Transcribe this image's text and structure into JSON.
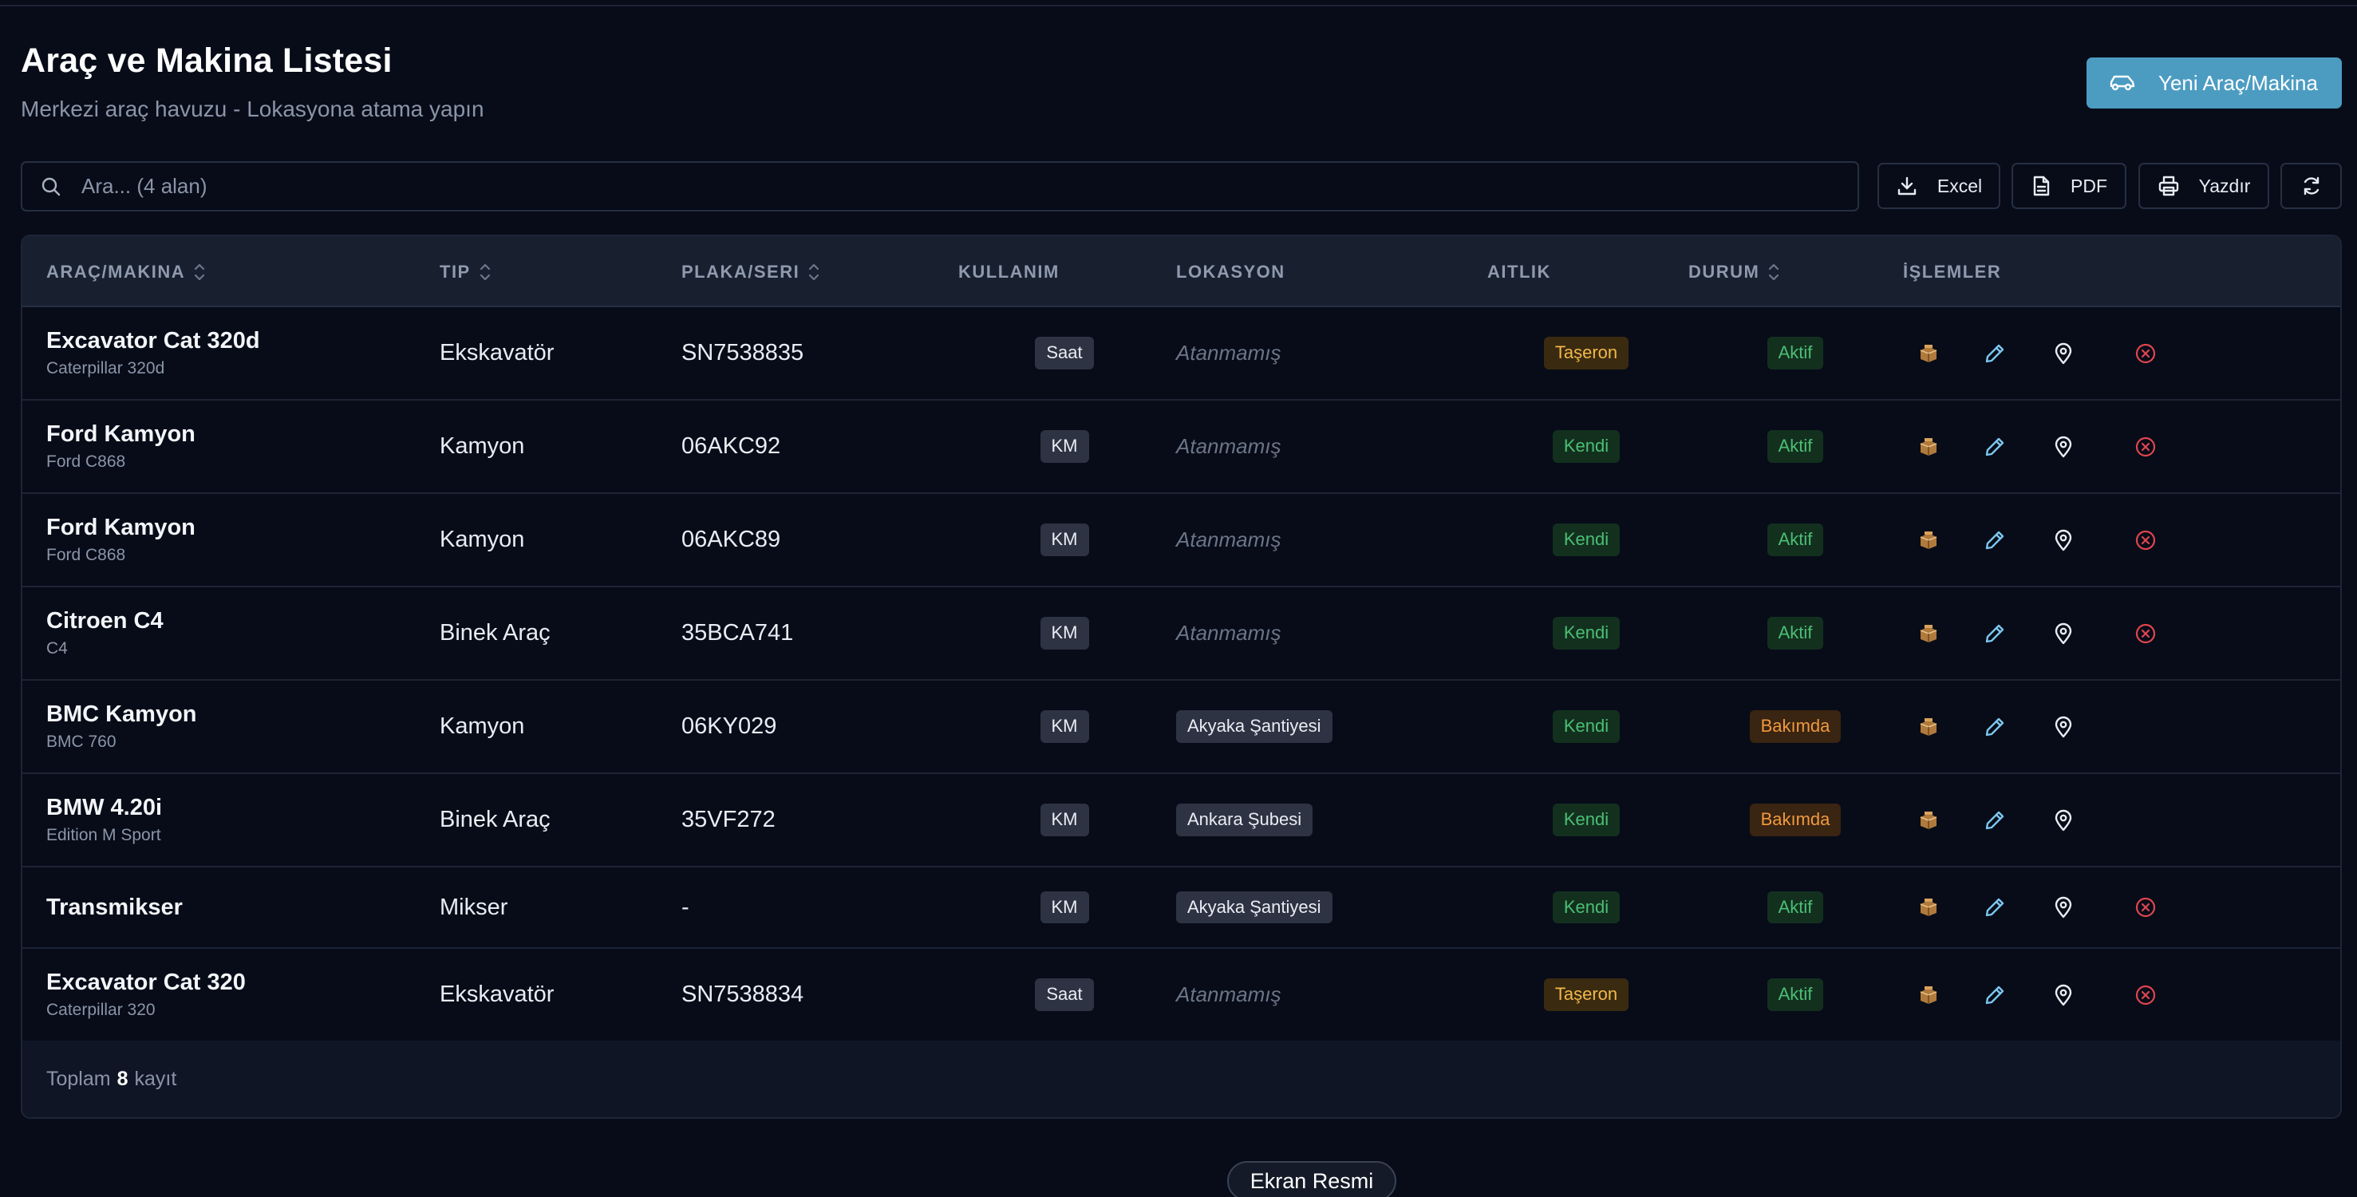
{
  "page": {
    "title": "Araç ve Makina Listesi",
    "subtitle": "Merkezi araç havuzu - Lokasyona atama yapın",
    "new_button": "Yeni Araç/Makina"
  },
  "search": {
    "placeholder": "Ara... (4 alan)"
  },
  "toolbar": {
    "excel": "Excel",
    "pdf": "PDF",
    "print": "Yazdır"
  },
  "columns": {
    "vehicle": "ARAÇ/MAKINA",
    "type": "TIP",
    "plate": "PLAKA/SERI",
    "usage": "KULLANIM",
    "location": "LOKASYON",
    "ownership": "AITLIK",
    "status": "DURUM",
    "actions": "İŞLEMLER"
  },
  "rows": [
    {
      "name": "Excavator Cat 320d",
      "model": "Caterpillar 320d",
      "type": "Ekskavatör",
      "plate": "SN7538835",
      "usage": "Saat",
      "location": "Atanmamış",
      "location_assigned": false,
      "ownership": "Taşeron",
      "status": "Aktif",
      "deletable": true
    },
    {
      "name": "Ford Kamyon",
      "model": "Ford C868",
      "type": "Kamyon",
      "plate": "06AKC92",
      "usage": "KM",
      "location": "Atanmamış",
      "location_assigned": false,
      "ownership": "Kendi",
      "status": "Aktif",
      "deletable": true
    },
    {
      "name": "Ford Kamyon",
      "model": "Ford C868",
      "type": "Kamyon",
      "plate": "06AKC89",
      "usage": "KM",
      "location": "Atanmamış",
      "location_assigned": false,
      "ownership": "Kendi",
      "status": "Aktif",
      "deletable": true
    },
    {
      "name": "Citroen C4",
      "model": "C4",
      "type": "Binek Araç",
      "plate": "35BCA741",
      "usage": "KM",
      "location": "Atanmamış",
      "location_assigned": false,
      "ownership": "Kendi",
      "status": "Aktif",
      "deletable": true
    },
    {
      "name": "BMC Kamyon",
      "model": "BMC 760",
      "type": "Kamyon",
      "plate": "06KY029",
      "usage": "KM",
      "location": "Akyaka Şantiyesi",
      "location_assigned": true,
      "ownership": "Kendi",
      "status": "Bakımda",
      "deletable": false
    },
    {
      "name": "BMW 4.20i",
      "model": "Edition M Sport",
      "type": "Binek Araç",
      "plate": "35VF272",
      "usage": "KM",
      "location": "Ankara Şubesi",
      "location_assigned": true,
      "ownership": "Kendi",
      "status": "Bakımda",
      "deletable": false
    },
    {
      "name": "Transmikser",
      "model": "",
      "type": "Mikser",
      "plate": "-",
      "usage": "KM",
      "location": "Akyaka Şantiyesi",
      "location_assigned": true,
      "ownership": "Kendi",
      "status": "Aktif",
      "deletable": true
    },
    {
      "name": "Excavator Cat 320",
      "model": "Caterpillar 320",
      "type": "Ekskavatör",
      "plate": "SN7538834",
      "usage": "Saat",
      "location": "Atanmamış",
      "location_assigned": false,
      "ownership": "Taşeron",
      "status": "Aktif",
      "deletable": true
    }
  ],
  "footer": {
    "prefix": "Toplam",
    "count": "8",
    "suffix": "kayıt"
  },
  "screenshot_button": "Ekran Resmi",
  "colors": {
    "primary": "#4c9cc2",
    "status_active": "#4bbf73",
    "status_maintenance": "#f09a3e",
    "ownership_subcontractor": "#f2b84a",
    "delete": "#e0454f",
    "edit": "#7cc6ee"
  },
  "icons": {
    "new_button": "car-icon",
    "search": "search-icon",
    "excel": "download-icon",
    "pdf": "file-icon",
    "print": "printer-icon",
    "refresh": "refresh-icon",
    "row_actions": [
      "package-icon",
      "pencil-icon",
      "map-pin-icon",
      "x-circle-icon"
    ]
  }
}
